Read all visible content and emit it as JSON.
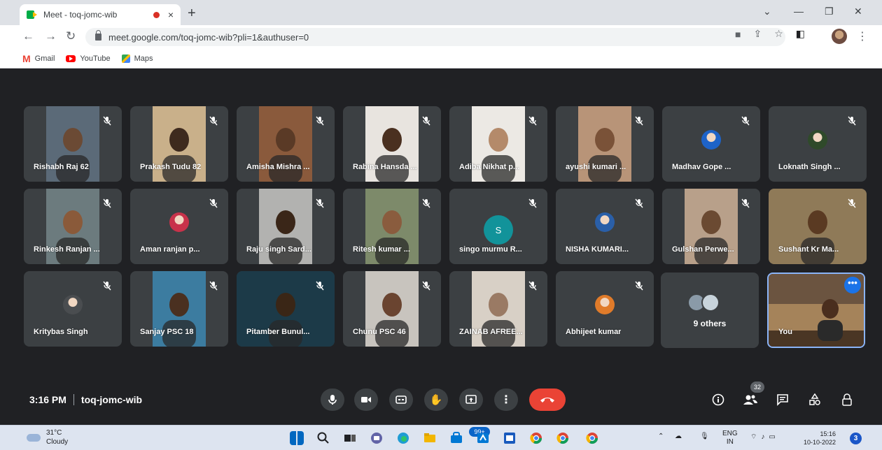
{
  "browser": {
    "tab_title": "Meet - toq-jomc-wib",
    "tab_close": "×",
    "new_tab": "+",
    "url": "meet.google.com/toq-jomc-wib?pli=1&authuser=0",
    "bookmarks": [
      {
        "label": "Gmail",
        "icon": "gmail-icon"
      },
      {
        "label": "YouTube",
        "icon": "youtube-icon"
      },
      {
        "label": "Maps",
        "icon": "maps-icon"
      }
    ]
  },
  "participants": [
    {
      "name": "Rishabh Raj 62",
      "kind": "video",
      "bg": "#5b6a78",
      "skin": "#6b4a34"
    },
    {
      "name": "Prakash Tudu 82",
      "kind": "video",
      "bg": "#c9b08a",
      "skin": "#3e2a1e"
    },
    {
      "name": "Amisha Mishra ...",
      "kind": "video",
      "bg": "#8a5a3c",
      "skin": "#5a3a26"
    },
    {
      "name": "Rabina Hansda ...",
      "kind": "video",
      "bg": "#e8e4df",
      "skin": "#4a3020"
    },
    {
      "name": "Adiba Nikhat p...",
      "kind": "video",
      "bg": "#ece9e4",
      "skin": "#b48a6a"
    },
    {
      "name": "ayushi kumari ...",
      "kind": "video",
      "bg": "#b89478",
      "skin": "#7a5238"
    },
    {
      "name": "Madhav Gope ...",
      "kind": "avatar",
      "avatar_color": "#1e63c8"
    },
    {
      "name": "Loknath Singh ...",
      "kind": "avatar",
      "avatar_color": "#2f4a2a"
    },
    {
      "name": "Rinkesh Ranjan ...",
      "kind": "video",
      "bg": "#6c7b7e",
      "skin": "#8a5a3a"
    },
    {
      "name": "Aman ranjan p...",
      "kind": "avatar",
      "avatar_color": "#c8324a"
    },
    {
      "name": "Raju singh Sard...",
      "kind": "video",
      "bg": "#b2b2b0",
      "skin": "#3a2618"
    },
    {
      "name": "Ritesh kumar ...",
      "kind": "video",
      "bg": "#7d8a6a",
      "skin": "#8a5c3e"
    },
    {
      "name": "singo murmu R...",
      "kind": "letter",
      "letter": "S"
    },
    {
      "name": "NISHA KUMARI...",
      "kind": "avatar",
      "avatar_color": "#2a5fa8"
    },
    {
      "name": "Gulshan Perwe...",
      "kind": "video",
      "bg": "#b8a08a",
      "skin": "#6b4a32"
    },
    {
      "name": "Sushant Kr Ma...",
      "kind": "wide",
      "bg": "#8f7a58",
      "skin": "#5a3a22"
    },
    {
      "name": "Kritybas Singh",
      "kind": "avatar",
      "avatar_color": "#4a4d50"
    },
    {
      "name": "Sanjay PSC 18",
      "kind": "video",
      "bg": "#3c7ca0",
      "skin": "#4a3020"
    },
    {
      "name": "Pitamber Bunul...",
      "kind": "wide",
      "bg": "#1c3a48",
      "skin": "#3a2616"
    },
    {
      "name": "Chunu PSC 46",
      "kind": "video",
      "bg": "#c8c4be",
      "skin": "#6a4430"
    },
    {
      "name": "ZAINAB AFREE...",
      "kind": "video",
      "bg": "#d8d0c6",
      "skin": "#9a7a64"
    },
    {
      "name": "Abhijeet kumar",
      "kind": "avatar",
      "avatar_color": "#e07b2a"
    }
  ],
  "others": {
    "label": "9 others"
  },
  "self": {
    "name": "You",
    "more": "•••"
  },
  "meeting": {
    "time": "3:16 PM",
    "code": "toq-jomc-wib"
  },
  "people_count": "32",
  "taskbar": {
    "temp": "31°C",
    "weather": "Cloudy",
    "badge": "99+",
    "lang": "ENG",
    "region": "IN",
    "time": "15:16",
    "date": "10-10-2022",
    "notifications": "3"
  },
  "colors": {
    "meet_bg": "#202124",
    "tile_bg": "#3c4043",
    "end_call": "#ea4335",
    "accent": "#1a73e8"
  }
}
